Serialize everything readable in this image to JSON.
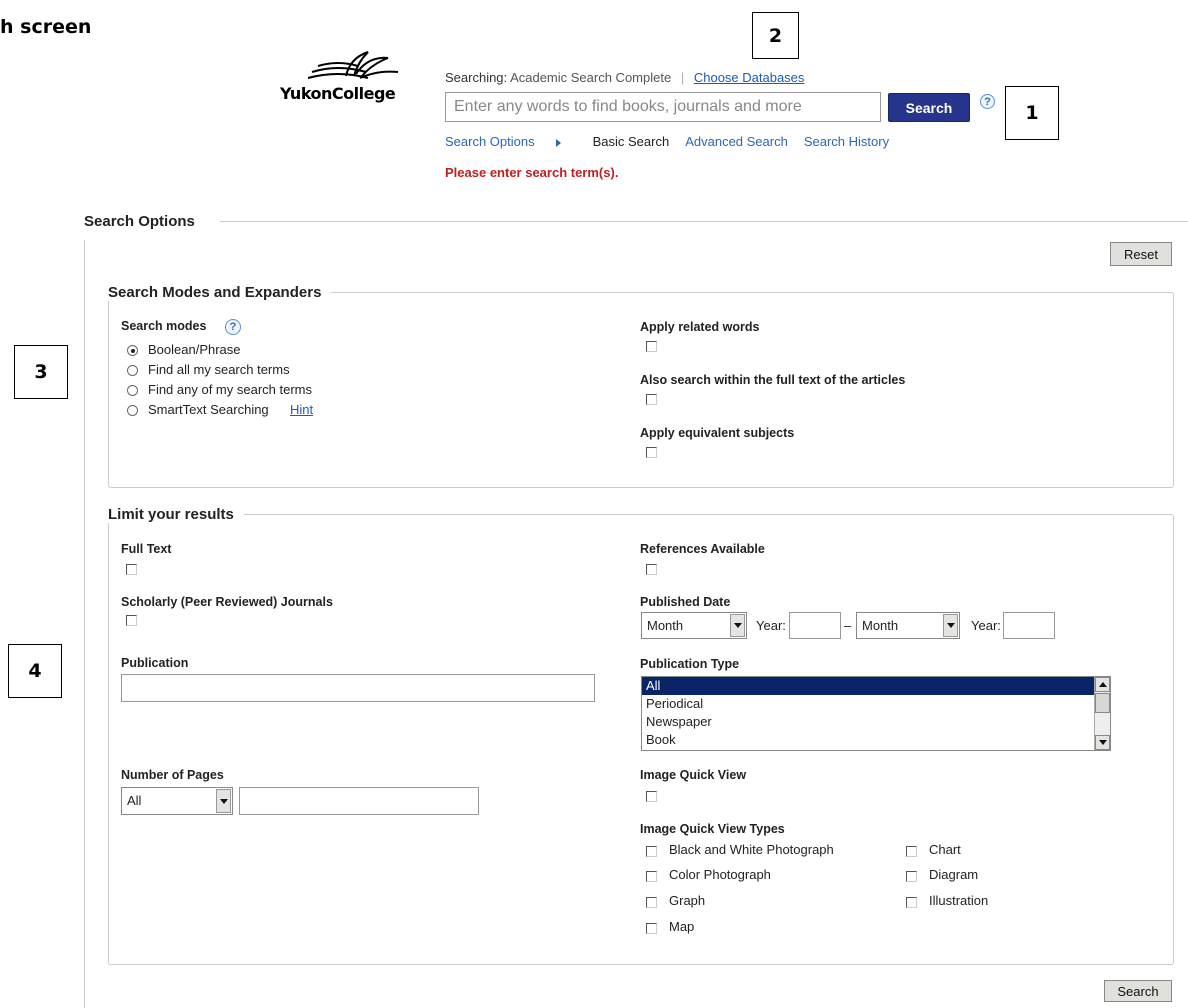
{
  "page": {
    "heading_fragment": "h screen"
  },
  "callouts": [
    "2",
    "1",
    "3",
    "4"
  ],
  "logo": {
    "text": "YukonCollege"
  },
  "header": {
    "searching_prefix": "Searching:",
    "database": "Academic Search Complete",
    "choose_databases": "Choose Databases",
    "search_placeholder": "Enter any words to find books, journals and more",
    "search_button": "Search",
    "help": "?",
    "nav": {
      "search_options": "Search Options",
      "basic_search": "Basic Search",
      "advanced_search": "Advanced Search",
      "search_history": "Search History"
    },
    "error": "Please enter search term(s)."
  },
  "search_options": {
    "title": "Search Options",
    "reset": "Reset",
    "modes": {
      "legend": "Search Modes and Expanders",
      "label": "Search modes",
      "options": [
        "Boolean/Phrase",
        "Find all my search terms",
        "Find any of my search terms",
        "SmartText Searching"
      ],
      "selected": "Boolean/Phrase",
      "hint": "Hint",
      "apply_related": "Apply related words",
      "full_text_search": "Also search within the full text of the articles",
      "equivalent_subjects": "Apply equivalent subjects"
    },
    "limits": {
      "legend": "Limit your results",
      "full_text": "Full Text",
      "scholarly": "Scholarly (Peer Reviewed) Journals",
      "publication": "Publication",
      "number_of_pages": "Number of Pages",
      "pages_select": "All",
      "references": "References Available",
      "published_date": "Published Date",
      "month": "Month",
      "year": "Year:",
      "dash": "–",
      "publication_type": "Publication Type",
      "pub_types": [
        "All",
        "Periodical",
        "Newspaper",
        "Book"
      ],
      "pub_type_selected": "All",
      "image_quick_view": "Image Quick View",
      "image_quick_view_types": "Image Quick View Types",
      "iqv_left": [
        "Black and White Photograph",
        "Color Photograph",
        "Graph",
        "Map"
      ],
      "iqv_right": [
        "Chart",
        "Diagram",
        "Illustration"
      ]
    },
    "bottom_search": "Search"
  }
}
